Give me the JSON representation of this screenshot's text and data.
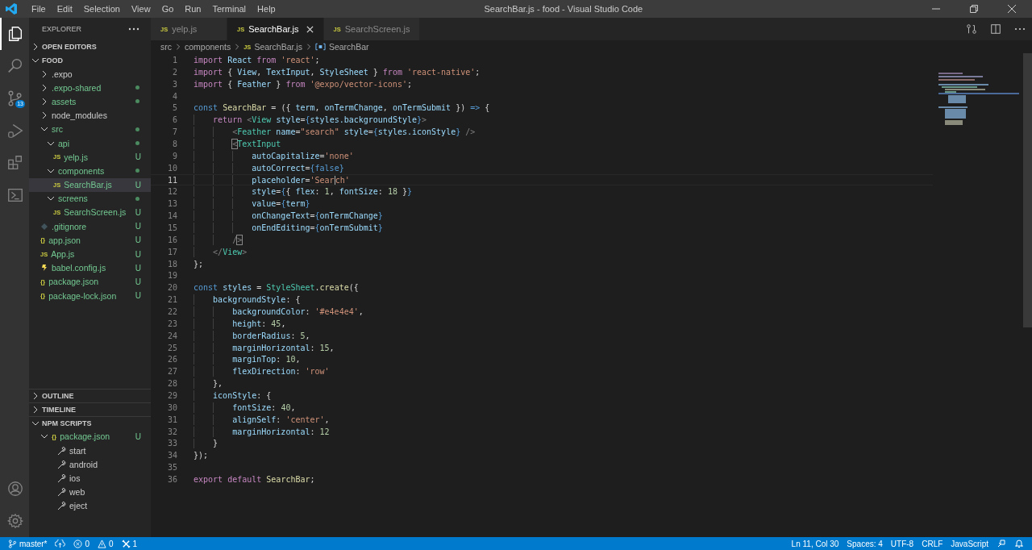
{
  "window": {
    "title": "SearchBar.js - food - Visual Studio Code"
  },
  "menu": [
    "File",
    "Edit",
    "Selection",
    "View",
    "Go",
    "Run",
    "Terminal",
    "Help"
  ],
  "activity_bar": [
    {
      "kind": "explorer",
      "selected": true
    },
    {
      "kind": "search",
      "selected": false
    },
    {
      "kind": "source-control",
      "selected": false,
      "badge": "13"
    },
    {
      "kind": "run",
      "selected": false
    },
    {
      "kind": "extensions",
      "selected": false
    },
    {
      "kind": "remote",
      "selected": false
    }
  ],
  "activity_bottom": [
    {
      "kind": "account"
    },
    {
      "kind": "settings"
    }
  ],
  "sidebar": {
    "title": "EXPLORER",
    "open_editors": {
      "label": "OPEN EDITORS",
      "expanded": false
    },
    "folder": {
      "label": "FOOD",
      "expanded": true
    },
    "items": [
      {
        "name": ".expo",
        "kind": "folder",
        "expanded": false,
        "selected": false,
        "untracked": false,
        "dot": false
      },
      {
        "name": ".expo-shared",
        "kind": "folder",
        "expanded": false,
        "selected": false,
        "untracked": true,
        "dot": true
      },
      {
        "name": "assets",
        "kind": "folder",
        "expanded": false,
        "selected": false,
        "untracked": true,
        "dot": true
      },
      {
        "name": "node_modules",
        "kind": "folder",
        "expanded": false,
        "selected": false,
        "untracked": false,
        "dot": false
      },
      {
        "name": "src",
        "kind": "folder",
        "expanded": true,
        "selected": false,
        "untracked": true,
        "dot": true,
        "children": [
          {
            "name": "api",
            "kind": "folder",
            "expanded": true,
            "selected": false,
            "untracked": true,
            "dot": true,
            "children": [
              {
                "name": "yelp.js",
                "kind": "js",
                "icon": "JS",
                "selected": false,
                "untracked": true,
                "badge": "U"
              }
            ]
          },
          {
            "name": "components",
            "kind": "folder",
            "expanded": true,
            "selected": false,
            "untracked": true,
            "dot": true,
            "children": [
              {
                "name": "SearchBar.js",
                "kind": "js",
                "icon": "JS",
                "selected": true,
                "untracked": true,
                "badge": "U"
              }
            ]
          },
          {
            "name": "screens",
            "kind": "folder",
            "expanded": true,
            "selected": false,
            "untracked": true,
            "dot": true,
            "children": [
              {
                "name": "SearchScreen.js",
                "kind": "js",
                "icon": "JS",
                "selected": false,
                "untracked": true,
                "badge": "U"
              }
            ]
          }
        ]
      },
      {
        "name": ".gitignore",
        "kind": "git",
        "selected": false,
        "untracked": true,
        "badge": "U"
      },
      {
        "name": "app.json",
        "kind": "json",
        "icon": "{}",
        "selected": false,
        "untracked": true,
        "badge": "U"
      },
      {
        "name": "App.js",
        "kind": "js",
        "icon": "JS",
        "selected": false,
        "untracked": true,
        "badge": "U"
      },
      {
        "name": "babel.config.js",
        "kind": "babel",
        "selected": false,
        "untracked": true,
        "badge": "U"
      },
      {
        "name": "package.json",
        "kind": "json",
        "icon": "{}",
        "selected": false,
        "untracked": true,
        "badge": "U"
      },
      {
        "name": "package-lock.json",
        "kind": "json",
        "icon": "{}",
        "selected": false,
        "untracked": true,
        "badge": "U"
      }
    ],
    "outline": {
      "label": "OUTLINE",
      "expanded": false
    },
    "timeline": {
      "label": "TIMELINE",
      "expanded": false
    },
    "npm_scripts": {
      "label": "NPM SCRIPTS",
      "expanded": true,
      "package": {
        "name": "package.json",
        "icon": "{}",
        "expanded": true,
        "badge": "U"
      },
      "scripts": [
        "start",
        "android",
        "ios",
        "web",
        "eject"
      ]
    }
  },
  "tabs": [
    {
      "label": "yelp.js",
      "icon": "JS",
      "selected": false
    },
    {
      "label": "SearchBar.js",
      "icon": "JS",
      "selected": true
    },
    {
      "label": "SearchScreen.js",
      "icon": "JS",
      "selected": false
    }
  ],
  "breadcrumb": [
    {
      "text": "src",
      "kind": "folder"
    },
    {
      "text": "components",
      "kind": "folder"
    },
    {
      "text": "SearchBar.js",
      "kind": "file",
      "icon": "JS"
    },
    {
      "text": "SearchBar",
      "kind": "symbol"
    }
  ],
  "code": [
    {
      "number": "1",
      "current": false,
      "tokens": [
        {
          "text": "import",
          "kind": "keyword"
        },
        {
          "text": " React ",
          "kind": "variable"
        },
        {
          "text": "from",
          "kind": "keyword"
        },
        {
          "text": " 'react'",
          "kind": "string"
        },
        {
          "text": ";",
          "kind": "plain"
        }
      ]
    },
    {
      "number": "2",
      "current": false,
      "tokens": [
        {
          "text": "import",
          "kind": "keyword"
        },
        {
          "text": " { ",
          "kind": "plain"
        },
        {
          "text": "View",
          "kind": "variable"
        },
        {
          "text": ", ",
          "kind": "plain"
        },
        {
          "text": "TextInput",
          "kind": "variable"
        },
        {
          "text": ", ",
          "kind": "plain"
        },
        {
          "text": "StyleSheet",
          "kind": "variable"
        },
        {
          "text": " } ",
          "kind": "plain"
        },
        {
          "text": "from",
          "kind": "keyword"
        },
        {
          "text": " 'react-native'",
          "kind": "string"
        },
        {
          "text": ";",
          "kind": "plain"
        }
      ]
    },
    {
      "number": "3",
      "current": false,
      "tokens": [
        {
          "text": "import",
          "kind": "keyword"
        },
        {
          "text": " { ",
          "kind": "plain"
        },
        {
          "text": "Feather",
          "kind": "variable"
        },
        {
          "text": " } ",
          "kind": "plain"
        },
        {
          "text": "from",
          "kind": "keyword"
        },
        {
          "text": " '@expo/vector-icons'",
          "kind": "string"
        },
        {
          "text": ";",
          "kind": "plain"
        }
      ]
    },
    {
      "number": "4",
      "current": false
    },
    {
      "number": "5",
      "current": false,
      "tokens": [
        {
          "text": "const",
          "kind": "storage"
        },
        {
          "text": " SearchBar",
          "kind": "function"
        },
        {
          "text": " = ({ ",
          "kind": "plain"
        },
        {
          "text": "term",
          "kind": "variable"
        },
        {
          "text": ", ",
          "kind": "plain"
        },
        {
          "text": "onTermChange",
          "kind": "variable"
        },
        {
          "text": ", ",
          "kind": "plain"
        },
        {
          "text": "onTermSubmit",
          "kind": "variable"
        },
        {
          "text": " }) ",
          "kind": "plain"
        },
        {
          "text": "=>",
          "kind": "storage"
        },
        {
          "text": " {",
          "kind": "plain"
        }
      ]
    },
    {
      "number": "6",
      "current": false,
      "tokens": [
        {
          "text": "    return",
          "kind": "keyword"
        },
        {
          "text": " <",
          "kind": "tag"
        },
        {
          "text": "View",
          "kind": "class"
        },
        {
          "text": " style",
          "kind": "variable"
        },
        {
          "text": "=",
          "kind": "plain"
        },
        {
          "text": "{",
          "kind": "brace"
        },
        {
          "text": "styles.backgroundStyle",
          "kind": "variable"
        },
        {
          "text": "}",
          "kind": "brace"
        },
        {
          "text": ">",
          "kind": "tag"
        }
      ]
    },
    {
      "number": "7",
      "current": false,
      "tokens": [
        {
          "text": "        <",
          "kind": "tag"
        },
        {
          "text": "Feather",
          "kind": "class"
        },
        {
          "text": " name",
          "kind": "variable"
        },
        {
          "text": "=",
          "kind": "plain"
        },
        {
          "text": "\"search\"",
          "kind": "string"
        },
        {
          "text": " style",
          "kind": "variable"
        },
        {
          "text": "=",
          "kind": "plain"
        },
        {
          "text": "{",
          "kind": "brace"
        },
        {
          "text": "styles.iconStyle",
          "kind": "variable"
        },
        {
          "text": "}",
          "kind": "brace"
        },
        {
          "text": " />",
          "kind": "tag"
        }
      ]
    },
    {
      "number": "8",
      "current": false,
      "tokens": [
        {
          "text": "        <",
          "kind": "tag-matched"
        },
        {
          "text": "TextInput",
          "kind": "class"
        }
      ]
    },
    {
      "number": "9",
      "current": false,
      "tokens": [
        {
          "text": "            autoCapitalize",
          "kind": "variable"
        },
        {
          "text": "=",
          "kind": "plain"
        },
        {
          "text": "'none'",
          "kind": "string"
        }
      ]
    },
    {
      "number": "10",
      "current": false,
      "tokens": [
        {
          "text": "            autoCorrect",
          "kind": "variable"
        },
        {
          "text": "=",
          "kind": "plain"
        },
        {
          "text": "{",
          "kind": "brace"
        },
        {
          "text": "false",
          "kind": "storage"
        },
        {
          "text": "}",
          "kind": "brace"
        }
      ]
    },
    {
      "number": "11",
      "current": true,
      "tokens": [
        {
          "text": "            placeholder",
          "kind": "variable"
        },
        {
          "text": "=",
          "kind": "plain"
        },
        {
          "text": "'Sear",
          "kind": "string"
        },
        {
          "text": "ch'",
          "kind": "string-caret"
        }
      ]
    },
    {
      "number": "12",
      "current": false,
      "tokens": [
        {
          "text": "            style",
          "kind": "variable"
        },
        {
          "text": "=",
          "kind": "plain"
        },
        {
          "text": "{",
          "kind": "brace"
        },
        {
          "text": "{ ",
          "kind": "plain"
        },
        {
          "text": "flex",
          "kind": "variable"
        },
        {
          "text": ": ",
          "kind": "plain"
        },
        {
          "text": "1",
          "kind": "number"
        },
        {
          "text": ", ",
          "kind": "plain"
        },
        {
          "text": "fontSize",
          "kind": "variable"
        },
        {
          "text": ": ",
          "kind": "plain"
        },
        {
          "text": "18",
          "kind": "number"
        },
        {
          "text": " }",
          "kind": "plain"
        },
        {
          "text": "}",
          "kind": "brace"
        }
      ]
    },
    {
      "number": "13",
      "current": false,
      "tokens": [
        {
          "text": "            value",
          "kind": "variable"
        },
        {
          "text": "=",
          "kind": "plain"
        },
        {
          "text": "{",
          "kind": "brace"
        },
        {
          "text": "term",
          "kind": "variable"
        },
        {
          "text": "}",
          "kind": "brace"
        }
      ]
    },
    {
      "number": "14",
      "current": false,
      "tokens": [
        {
          "text": "            onChangeText",
          "kind": "variable"
        },
        {
          "text": "=",
          "kind": "plain"
        },
        {
          "text": "{",
          "kind": "brace"
        },
        {
          "text": "onTermChange",
          "kind": "variable"
        },
        {
          "text": "}",
          "kind": "brace"
        }
      ]
    },
    {
      "number": "15",
      "current": false,
      "tokens": [
        {
          "text": "            onEndEditing",
          "kind": "variable"
        },
        {
          "text": "=",
          "kind": "plain"
        },
        {
          "text": "{",
          "kind": "brace"
        },
        {
          "text": "onTermSubmit",
          "kind": "variable"
        },
        {
          "text": "}",
          "kind": "brace"
        }
      ]
    },
    {
      "number": "16",
      "current": false,
      "tokens": [
        {
          "text": "        /",
          "kind": "tag"
        },
        {
          "text": ">",
          "kind": "tag-matched"
        }
      ]
    },
    {
      "number": "17",
      "current": false,
      "tokens": [
        {
          "text": "    </",
          "kind": "tag"
        },
        {
          "text": "View",
          "kind": "class"
        },
        {
          "text": ">",
          "kind": "tag"
        }
      ]
    },
    {
      "number": "18",
      "current": false,
      "tokens": [
        {
          "text": "};",
          "kind": "plain"
        }
      ]
    },
    {
      "number": "19",
      "current": false
    },
    {
      "number": "20",
      "current": false,
      "tokens": [
        {
          "text": "const",
          "kind": "storage"
        },
        {
          "text": " styles",
          "kind": "variable"
        },
        {
          "text": " = ",
          "kind": "plain"
        },
        {
          "text": "StyleSheet",
          "kind": "class"
        },
        {
          "text": ".",
          "kind": "plain"
        },
        {
          "text": "create",
          "kind": "function"
        },
        {
          "text": "({",
          "kind": "plain"
        }
      ]
    },
    {
      "number": "21",
      "current": false,
      "tokens": [
        {
          "text": "    backgroundStyle",
          "kind": "variable"
        },
        {
          "text": ": {",
          "kind": "plain"
        }
      ]
    },
    {
      "number": "22",
      "current": false,
      "tokens": [
        {
          "text": "        backgroundColor",
          "kind": "variable"
        },
        {
          "text": ": ",
          "kind": "plain"
        },
        {
          "text": "'#e4e4e4'",
          "kind": "string"
        },
        {
          "text": ",",
          "kind": "plain"
        }
      ]
    },
    {
      "number": "23",
      "current": false,
      "tokens": [
        {
          "text": "        height",
          "kind": "variable"
        },
        {
          "text": ": ",
          "kind": "plain"
        },
        {
          "text": "45",
          "kind": "number"
        },
        {
          "text": ",",
          "kind": "plain"
        }
      ]
    },
    {
      "number": "24",
      "current": false,
      "tokens": [
        {
          "text": "        borderRadius",
          "kind": "variable"
        },
        {
          "text": ": ",
          "kind": "plain"
        },
        {
          "text": "5",
          "kind": "number"
        },
        {
          "text": ",",
          "kind": "plain"
        }
      ]
    },
    {
      "number": "25",
      "current": false,
      "tokens": [
        {
          "text": "        marginHorizontal",
          "kind": "variable"
        },
        {
          "text": ": ",
          "kind": "plain"
        },
        {
          "text": "15",
          "kind": "number"
        },
        {
          "text": ",",
          "kind": "plain"
        }
      ]
    },
    {
      "number": "26",
      "current": false,
      "tokens": [
        {
          "text": "        marginTop",
          "kind": "variable"
        },
        {
          "text": ": ",
          "kind": "plain"
        },
        {
          "text": "10",
          "kind": "number"
        },
        {
          "text": ",",
          "kind": "plain"
        }
      ]
    },
    {
      "number": "27",
      "current": false,
      "tokens": [
        {
          "text": "        flexDirection",
          "kind": "variable"
        },
        {
          "text": ": ",
          "kind": "plain"
        },
        {
          "text": "'row'",
          "kind": "string"
        }
      ]
    },
    {
      "number": "28",
      "current": false,
      "tokens": [
        {
          "text": "    },",
          "kind": "plain"
        }
      ]
    },
    {
      "number": "29",
      "current": false,
      "tokens": [
        {
          "text": "    iconStyle",
          "kind": "variable"
        },
        {
          "text": ": {",
          "kind": "plain"
        }
      ]
    },
    {
      "number": "30",
      "current": false,
      "tokens": [
        {
          "text": "        fontSize",
          "kind": "variable"
        },
        {
          "text": ": ",
          "kind": "plain"
        },
        {
          "text": "40",
          "kind": "number"
        },
        {
          "text": ",",
          "kind": "plain"
        }
      ]
    },
    {
      "number": "31",
      "current": false,
      "tokens": [
        {
          "text": "        alignSelf",
          "kind": "variable"
        },
        {
          "text": ": ",
          "kind": "plain"
        },
        {
          "text": "'center'",
          "kind": "string"
        },
        {
          "text": ",",
          "kind": "plain"
        }
      ]
    },
    {
      "number": "32",
      "current": false,
      "tokens": [
        {
          "text": "        marginHorizontal",
          "kind": "variable"
        },
        {
          "text": ": ",
          "kind": "plain"
        },
        {
          "text": "12",
          "kind": "number"
        }
      ]
    },
    {
      "number": "33",
      "current": false,
      "tokens": [
        {
          "text": "    }",
          "kind": "plain"
        }
      ]
    },
    {
      "number": "34",
      "current": false,
      "tokens": [
        {
          "text": "});",
          "kind": "plain"
        }
      ]
    },
    {
      "number": "35",
      "current": false
    },
    {
      "number": "36",
      "current": false,
      "tokens": [
        {
          "text": "export default",
          "kind": "keyword"
        },
        {
          "text": " SearchBar",
          "kind": "function"
        },
        {
          "text": ";",
          "kind": "plain"
        }
      ]
    }
  ],
  "status_bar": {
    "left": [
      {
        "kind": "branch",
        "text": "master*"
      },
      {
        "kind": "sync"
      },
      {
        "kind": "errors",
        "text": "0"
      },
      {
        "kind": "warnings",
        "text": "0"
      },
      {
        "kind": "tools",
        "text": "1"
      }
    ],
    "right": [
      {
        "kind": "text",
        "text": "Ln 11, Col 30"
      },
      {
        "kind": "text",
        "text": "Spaces: 4"
      },
      {
        "kind": "text",
        "text": "UTF-8"
      },
      {
        "kind": "text",
        "text": "CRLF"
      },
      {
        "kind": "text",
        "text": "JavaScript"
      },
      {
        "kind": "feedback"
      },
      {
        "kind": "bell"
      }
    ]
  }
}
